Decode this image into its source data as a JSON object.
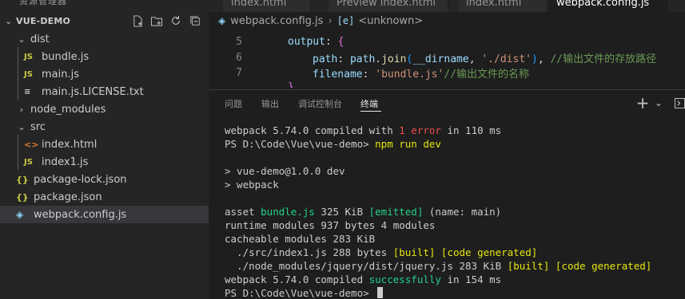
{
  "sidebar": {
    "header_partial": "资源管理器",
    "root": {
      "title": "VUE-DEMO"
    },
    "actions": [
      {
        "name": "new-file",
        "glyph": "⊞"
      },
      {
        "name": "new-folder",
        "glyph": "⊟"
      },
      {
        "name": "refresh",
        "glyph": "↻"
      },
      {
        "name": "collapse-all",
        "glyph": "⧉"
      }
    ],
    "items": [
      {
        "label": "dist",
        "kind": "folder-open"
      },
      {
        "label": "bundle.js",
        "kind": "js",
        "icon_text": "JS"
      },
      {
        "label": "main.js",
        "kind": "js",
        "icon_text": "JS"
      },
      {
        "label": "main.js.LICENSE.txt",
        "kind": "txt",
        "icon_text": "≡"
      },
      {
        "label": "node_modules",
        "kind": "folder-closed"
      },
      {
        "label": "src",
        "kind": "folder-open"
      },
      {
        "label": "index.html",
        "kind": "html",
        "icon_text": "<>"
      },
      {
        "label": "index1.js",
        "kind": "js",
        "icon_text": "JS"
      },
      {
        "label": "package-lock.json",
        "kind": "json",
        "icon_text": "{}"
      },
      {
        "label": "package.json",
        "kind": "json",
        "icon_text": "{}"
      },
      {
        "label": "webpack.config.js",
        "kind": "webpack",
        "icon_text": "◈"
      }
    ]
  },
  "tabs": [
    {
      "label": "index.html"
    },
    {
      "label": "Preview index.html"
    },
    {
      "label": "index.html"
    },
    {
      "label": "webpack.config.js"
    }
  ],
  "breadcrumb": {
    "file": "webpack.config.js",
    "symbol_icon": "[e]",
    "symbol": "<unknown>"
  },
  "editor": {
    "line_numbers": [
      "5",
      "6",
      "7"
    ],
    "line5": {
      "prop": "output",
      "colon": ": ",
      "brace": "{"
    },
    "line6": {
      "prop": "path",
      "colon": ": ",
      "obj": "path",
      "dot": ".",
      "fn": "join",
      "lp": "(",
      "arg1": "__dirname",
      "comma": ", ",
      "arg2": "'./dist'",
      "rp": ")",
      "trail": ", ",
      "comment": "//输出文件的存放路径"
    },
    "line7": {
      "prop": "filename",
      "colon": ": ",
      "str": "'bundle.js'",
      "comment": "//输出文件的名称"
    },
    "line8": {
      "brace": "}"
    }
  },
  "panel": {
    "tabs": [
      "问题",
      "输出",
      "调试控制台",
      "终端"
    ],
    "active_tab": "终端",
    "actions": {
      "add": "+",
      "dropdown": "⌄",
      "split": "⊡"
    }
  },
  "terminal": {
    "l1_a": "webpack 5.74.0 compiled with ",
    "l1_err": "1 error",
    "l1_b": " in 110 ms",
    "l2_prompt": "PS D:\\Code\\Vue\\vue-demo> ",
    "l2_cmd": "npm run dev",
    "l3": "",
    "l4": "> vue-demo@1.0.0 dev",
    "l5": "> webpack",
    "l6": "",
    "l7_a": "asset ",
    "l7_file": "bundle.js",
    "l7_b": " 325 KiB ",
    "l7_tag": "[emitted]",
    "l7_c": " (name: main)",
    "l8": "runtime modules 937 bytes 4 modules",
    "l9": "cacheable modules 283 KiB",
    "l10_a": "  ./src/index1.js 288 bytes ",
    "l10_tag": "[built] [code generated]",
    "l11_a": "  ./node_modules/jquery/dist/jquery.js 283 KiB ",
    "l11_tag": "[built] [code generated]",
    "l12_a": "webpack 5.74.0 compiled ",
    "l12_ok": "successfully",
    "l12_b": " in 154 ms",
    "l13_prompt": "PS D:\\Code\\Vue\\vue-demo> "
  }
}
